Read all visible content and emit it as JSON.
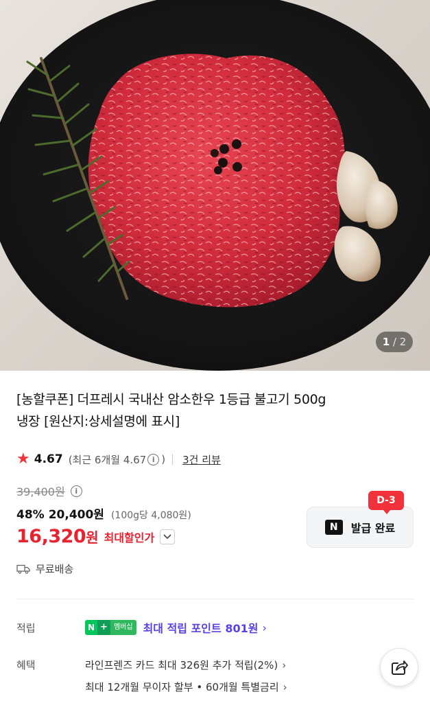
{
  "gallery": {
    "current": "1",
    "separator": "/",
    "total": "2"
  },
  "product": {
    "title_line1": "[농할쿠폰] 더프레시 국내산 암소한우 1등급 불고기 500g",
    "title_line2": "냉장 [원산지:상세설명에 표시]"
  },
  "rating": {
    "star": "★",
    "score": "4.67",
    "recent_prefix": "(최근 6개월 4.67",
    "recent_suffix": ")",
    "info_glyph": "i",
    "reviews": "3건 리뷰"
  },
  "price": {
    "original": "39,400원",
    "discount_pct": "48%",
    "sale": "20,400원",
    "unit_price": "(100g당 4,080원)",
    "max_price": "16,320",
    "max_won": "원",
    "max_label": "최대할인가"
  },
  "coupon": {
    "badge": "D-3",
    "logo": "N",
    "label": "발급 완료"
  },
  "shipping": {
    "label": "무료배송"
  },
  "points": {
    "row_label": "적립",
    "badge_n": "N",
    "badge_plus": "+",
    "badge_member": "멤버십",
    "text": "최대 적립 포인트 801원",
    "chevron": "›"
  },
  "benefits": {
    "row_label": "혜택",
    "items": [
      {
        "text": "라인프렌즈 카드 최대 326원 추가 적립(2%)",
        "chevron": "›"
      },
      {
        "text": "최대 12개월 무이자 할부 • 60개월 특별금리",
        "chevron": "›"
      }
    ]
  },
  "colors": {
    "accent_red": "#e8222e",
    "points_purple": "#5a3ee6",
    "naver_green": "#03c75a"
  }
}
